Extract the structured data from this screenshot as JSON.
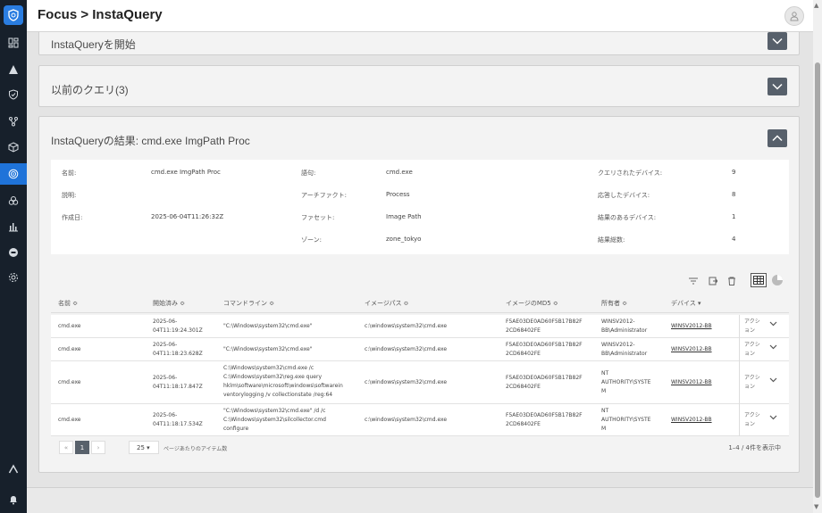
{
  "app": {
    "title": "Focus > InstaQuery"
  },
  "sidebar": {
    "items": [
      {
        "icon": "dashboard-icon",
        "active": false
      },
      {
        "icon": "alert-icon",
        "active": false
      },
      {
        "icon": "shield-icon",
        "active": false
      },
      {
        "icon": "network-icon",
        "active": false
      },
      {
        "icon": "cube-icon",
        "active": false
      },
      {
        "icon": "focus-icon",
        "active": true
      },
      {
        "icon": "biohazard-icon",
        "active": false
      },
      {
        "icon": "chart-icon",
        "active": false
      },
      {
        "icon": "badge-icon",
        "active": false
      },
      {
        "icon": "settings-icon",
        "active": false
      }
    ],
    "bottom_icons": [
      "collapse-icon",
      "notification-icon"
    ]
  },
  "panels": {
    "start": {
      "title": "InstaQueryを開始"
    },
    "previous": {
      "title": "以前のクエリ(3)"
    },
    "results": {
      "title": "InstaQueryの結果: cmd.exe ImgPath Proc"
    }
  },
  "info": {
    "name_label": "名前:",
    "name_value": "cmd.exe ImgPath Proc",
    "desc_label": "説明:",
    "created_label": "作成日:",
    "created_value": "2025-06-04T11:26:32Z",
    "term_label": "語句:",
    "term_value": "cmd.exe",
    "artifact_label": "アーチファクト:",
    "artifact_value": "Process",
    "facet_label": "ファセット:",
    "facet_value": "Image Path",
    "zone_label": "ゾーン:",
    "zone_value": "zone_tokyo",
    "queried_label": "クエリされたデバイス:",
    "queried_value": "9",
    "responded_label": "応答したデバイス:",
    "responded_value": "8",
    "with_results_label": "結果のあるデバイス:",
    "with_results_value": "1",
    "total_label": "結果総数:",
    "total_value": "4"
  },
  "table": {
    "columns": [
      "名前 ≎",
      "開始済み ≎",
      "コマンドライン ≎",
      "イメージパス ≎",
      "イメージのMD5 ≎",
      "所有者 ≎",
      "デバイス ▾"
    ],
    "rows": [
      {
        "name": "cmd.exe",
        "started": [
          "2025-06-",
          "04T11:19:24.301Z"
        ],
        "cmdline": [
          "\"C:\\Windows\\system32\\cmd.exe\""
        ],
        "imagepath": "c:\\windows\\system32\\cmd.exe",
        "md5": [
          "F5AE03DE0AD60F5B17B82F",
          "2CD68402FE"
        ],
        "owner": [
          "WINSV2012-",
          "BB\\Administrator"
        ],
        "device": "WINSV2012-BB",
        "action": [
          "アクシ",
          "ョン"
        ]
      },
      {
        "name": "cmd.exe",
        "started": [
          "2025-06-",
          "04T11:18:23.628Z"
        ],
        "cmdline": [
          "\"C:\\Windows\\system32\\cmd.exe\""
        ],
        "imagepath": "c:\\windows\\system32\\cmd.exe",
        "md5": [
          "F5AE03DE0AD60F5B17B82F",
          "2CD68402FE"
        ],
        "owner": [
          "WINSV2012-",
          "BB\\Administrator"
        ],
        "device": "WINSV2012-BB",
        "action": [
          "アクシ",
          "ョン"
        ]
      },
      {
        "name": "cmd.exe",
        "started": [
          "2025-06-",
          "04T11:18:17.847Z"
        ],
        "cmdline": [
          "C:\\Windows\\system32\\cmd.exe /c",
          "C:\\Windows\\system32\\reg.exe query",
          "hklm\\software\\microsoft\\windows\\softwarein",
          "ventorylogging /v collectionstate /reg:64"
        ],
        "imagepath": "c:\\windows\\system32\\cmd.exe",
        "md5": [
          "F5AE03DE0AD60F5B17B82F",
          "2CD68402FE"
        ],
        "owner": [
          "NT",
          "AUTHORITY\\SYSTE",
          "M"
        ],
        "device": "WINSV2012-BB",
        "action": [
          "アクシ",
          "ョン"
        ]
      },
      {
        "name": "cmd.exe",
        "started": [
          "2025-06-",
          "04T11:18:17.534Z"
        ],
        "cmdline": [
          "\"C:\\Windows\\system32\\cmd.exe\" /d /c",
          "C:\\Windows\\system32\\silcollector.cmd",
          "configure"
        ],
        "imagepath": "c:\\windows\\system32\\cmd.exe",
        "md5": [
          "F5AE03DE0AD60F5B17B82F",
          "2CD68402FE"
        ],
        "owner": [
          "NT",
          "AUTHORITY\\SYSTE",
          "M"
        ],
        "device": "WINSV2012-BB",
        "action": [
          "アクシ",
          "ョン"
        ]
      }
    ]
  },
  "pagination": {
    "prev": "«",
    "prev2": "‹",
    "current": "1",
    "next": "›",
    "per_page": "25 ▾",
    "per_page_label": "ページあたりのアイテム数",
    "range": "1–4 / 4件を表示中"
  },
  "colors": {
    "sidebar": "#17202b",
    "accent": "#1f73d9",
    "toggle": "#57606b"
  }
}
